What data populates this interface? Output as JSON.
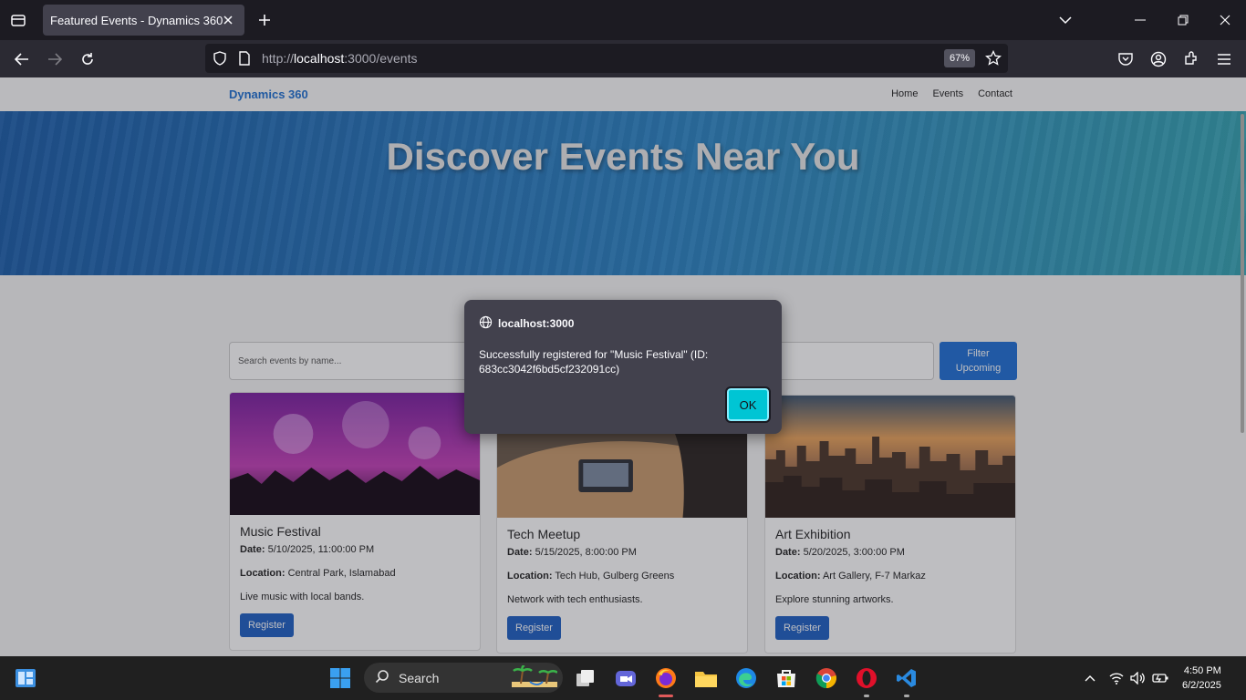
{
  "browser": {
    "tab_title": "Featured Events - Dynamics 360",
    "url_prefix": "http://",
    "url_host": "localhost",
    "url_rest": ":3000/events",
    "zoom": "67%"
  },
  "site": {
    "brand": "Dynamics 360",
    "nav": [
      "Home",
      "Events",
      "Contact"
    ],
    "hero_title": "Discover Events Near You",
    "search_placeholder": "Search events by name...",
    "filter_label_line1": "Filter",
    "filter_label_line2": "Upcoming"
  },
  "events": [
    {
      "title": "Music Festival",
      "date_label": "Date:",
      "date": "5/10/2025, 11:00:00 PM",
      "location_label": "Location:",
      "location": "Central Park, Islamabad",
      "description": "Live music with local bands.",
      "button": "Register"
    },
    {
      "title": "Tech Meetup",
      "date_label": "Date:",
      "date": "5/15/2025, 8:00:00 PM",
      "location_label": "Location:",
      "location": "Tech Hub, Gulberg Greens",
      "description": "Network with tech enthusiasts.",
      "button": "Register"
    },
    {
      "title": "Art Exhibition",
      "date_label": "Date:",
      "date": "5/20/2025, 3:00:00 PM",
      "location_label": "Location:",
      "location": "Art Gallery, F-7 Markaz",
      "description": "Explore stunning artworks.",
      "button": "Register"
    }
  ],
  "dialog": {
    "origin": "localhost:3000",
    "message": "Successfully registered for \"Music Festival\" (ID: 683cc3042f6bd5cf232091cc)",
    "ok": "OK"
  },
  "taskbar": {
    "search_label": "Search",
    "time": "4:50 PM",
    "date": "6/2/2025"
  }
}
